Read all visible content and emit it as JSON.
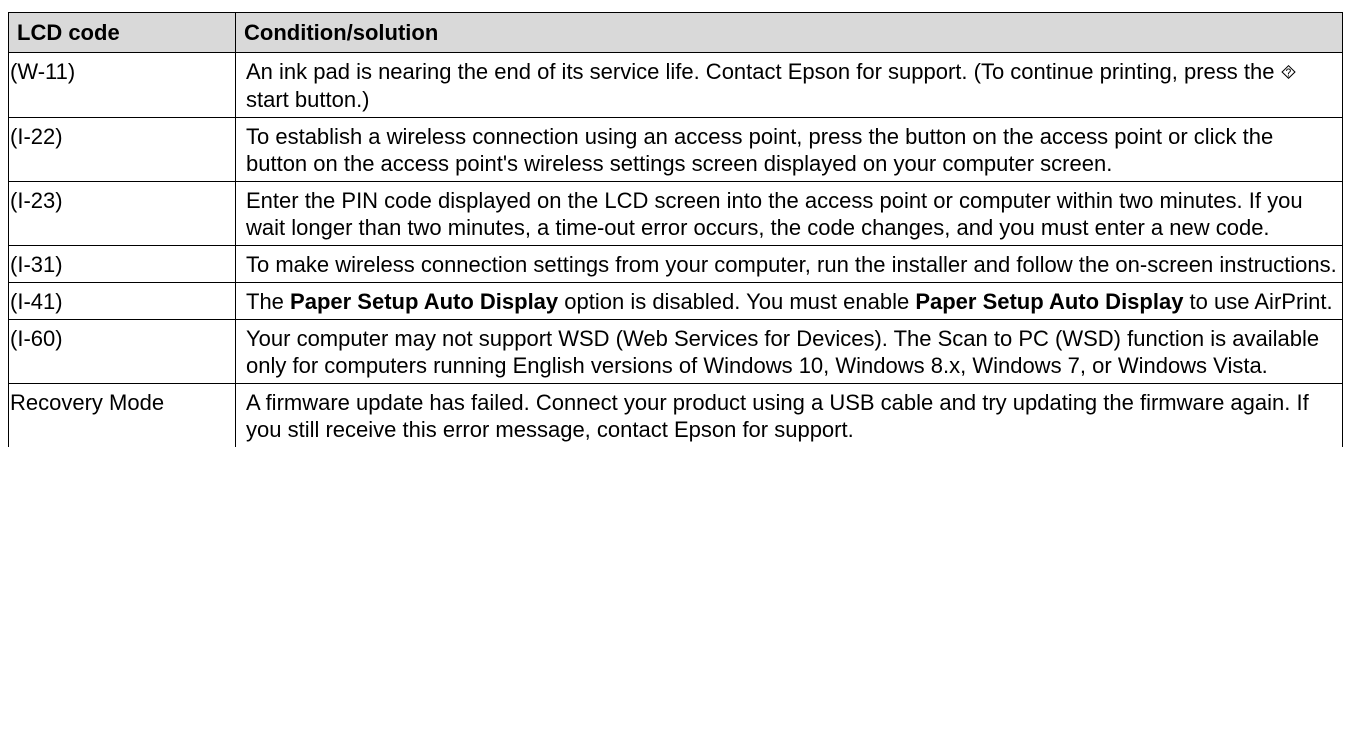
{
  "table": {
    "headers": {
      "code": "LCD code",
      "solution": "Condition/solution"
    },
    "rows": [
      {
        "code": "(W-11)",
        "solution_pre": "An ink pad is nearing the end of its service life. Contact Epson for support. (To continue printing, press the ",
        "start_icon_glyph": "⯑",
        "solution_post": " start button.)",
        "icon": "start-button-icon"
      },
      {
        "code": "(I-22)",
        "solution": "To establish a wireless connection using an access point, press the button on the access point or click the button on the access point's wireless settings screen displayed on your computer screen."
      },
      {
        "code": "(I-23)",
        "solution": "Enter the PIN code displayed on the LCD screen into the access point or computer within two minutes. If you wait longer than two minutes, a time-out error occurs, the code changes, and you must enter a new code."
      },
      {
        "code": "(I-31)",
        "solution": "To make wireless connection settings from your computer, run the installer and follow the on-screen instructions."
      },
      {
        "code": "(I-41)",
        "part1": "The ",
        "bold1": "Paper Setup Auto Display",
        "part2": " option is disabled. You must enable ",
        "bold2": "Paper Setup Auto Display",
        "part3": " to use AirPrint."
      },
      {
        "code": "(I-60)",
        "solution": "Your computer may not support WSD (Web Services for Devices). The Scan to PC (WSD) function is available only for computers running English versions of Windows 10, Windows 8.x, Windows 7, or Windows Vista."
      },
      {
        "code": "Recovery Mode",
        "solution": "A firmware update has failed. Connect your product using a USB cable and try updating the firmware again. If you still receive this error message, contact Epson for support."
      }
    ]
  },
  "colors": {
    "header_background": "#d9d9d9",
    "border": "#000000",
    "text": "#000000"
  }
}
